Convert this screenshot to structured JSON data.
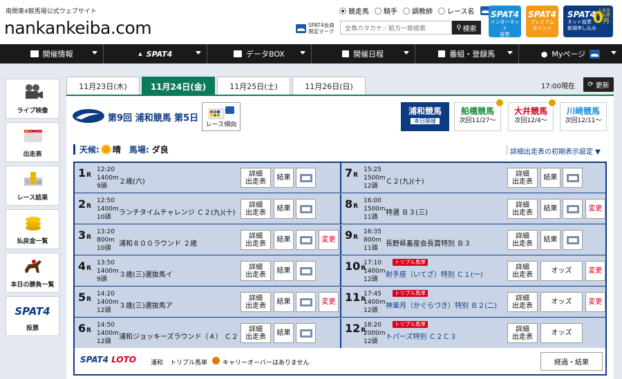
{
  "header": {
    "tagline": "南関東4競馬場公式ウェブサイト",
    "logo": "nankankeiba.com",
    "search_modes": [
      "競走馬",
      "騎手",
      "調教師",
      "レース名"
    ],
    "spat4_note_line1": "SPAT4会員",
    "spat4_note_line2": "限定マーク",
    "search_placeholder": "全角カタカナ／前方一致検索",
    "search_button": "検索",
    "promos": [
      {
        "logo": "SPAT4",
        "line1": "インターネット",
        "line2": "投票"
      },
      {
        "logo": "SPAT4",
        "line1": "プレミアム",
        "line2": "ポイント"
      },
      {
        "logo": "SPAT4",
        "line1": "ネット投票",
        "line2": "新規申し込み",
        "extra1": "入会金",
        "extra2": "年会費",
        "zero": "0",
        "yen": "円"
      }
    ]
  },
  "nav": [
    {
      "label": "開催情報",
      "icon": "calendar-grid-icon"
    },
    {
      "label": "SPAT4",
      "icon": "spat4-logo-icon"
    },
    {
      "label": "データBOX",
      "icon": "data-box-icon"
    },
    {
      "label": "開催日程",
      "icon": "calendar-icon"
    },
    {
      "label": "番組・登録馬",
      "icon": "program-icon"
    },
    {
      "label": "Myページ",
      "icon": "person-icon"
    }
  ],
  "sidebar": [
    {
      "label": "ライブ映像",
      "icon": "video-camera-icon"
    },
    {
      "label": "出走表",
      "icon": "entry-table-icon"
    },
    {
      "label": "レース結果",
      "icon": "race-result-icon"
    },
    {
      "label": "払戻金一覧",
      "icon": "coins-icon"
    },
    {
      "label": "本日の勝負一覧",
      "icon": "racehorse-icon"
    },
    {
      "label": "投票",
      "logo": "SPAT4"
    }
  ],
  "date_tabs": [
    "11月23日(木)",
    "11月24日(金)",
    "11月25日(土)",
    "11月26日(日)"
  ],
  "active_date": 1,
  "time_now": "17:00現在",
  "update_button": "更新",
  "meeting": "第9回 浦和競馬 第5日",
  "trend_button": "レース傾向",
  "venues": [
    {
      "name": "浦和競馬",
      "sub": "本日開催",
      "color": "#ffffff"
    },
    {
      "name": "船橋競馬",
      "sub": "次回11/27〜",
      "color": "#1a8a3c"
    },
    {
      "name": "大井競馬",
      "sub": "次回12/4〜",
      "color": "#d7001e"
    },
    {
      "name": "川崎競馬",
      "sub": "次回12/11〜",
      "color": "#1b8fd6"
    }
  ],
  "weather": {
    "weather_label": "天候:",
    "weather_value": "晴",
    "track_label": "馬場:",
    "track_value": "ダ良"
  },
  "initial_setting_link": "詳細出走表の初期表示設定 ▼",
  "race_unit": "R",
  "buttons": {
    "detail_line1": "詳細",
    "detail_line2": "出走表",
    "result": "結果",
    "odds": "オッズ",
    "change": "変更",
    "triple": "トリプル馬単"
  },
  "races": [
    {
      "no": "1",
      "time": "12:20",
      "dist": "1400m",
      "heads": "9頭",
      "name": "２歳(六)",
      "change": false,
      "triple": false,
      "odds": false,
      "link": false
    },
    {
      "no": "2",
      "time": "12:50",
      "dist": "1400m",
      "heads": "10頭",
      "name": "ランチタイムチャレンジ Ｃ２(九)(十)",
      "change": false,
      "triple": false,
      "odds": false,
      "link": false
    },
    {
      "no": "3",
      "time": "13:20",
      "dist": "800m",
      "heads": "10頭",
      "name": "浦和８００ラウンド ２歳",
      "change": true,
      "triple": false,
      "odds": false,
      "link": false
    },
    {
      "no": "4",
      "time": "13:50",
      "dist": "1400m",
      "heads": "9頭",
      "name": "３歳(三)選抜馬イ",
      "change": false,
      "triple": false,
      "odds": false,
      "link": false
    },
    {
      "no": "5",
      "time": "14:20",
      "dist": "1400m",
      "heads": "12頭",
      "name": "３歳(三)選抜馬ア",
      "change": true,
      "triple": false,
      "odds": false,
      "link": false
    },
    {
      "no": "6",
      "time": "14:50",
      "dist": "1400m",
      "heads": "12頭",
      "name": "浦和ジョッキーズラウンド（４） Ｃ２",
      "change": false,
      "triple": false,
      "odds": false,
      "link": false
    },
    {
      "no": "7",
      "time": "15:25",
      "dist": "1500m",
      "heads": "12頭",
      "name": "Ｃ２(九)(十)",
      "change": false,
      "triple": false,
      "odds": false,
      "link": false
    },
    {
      "no": "8",
      "time": "16:00",
      "dist": "1500m",
      "heads": "11頭",
      "name": "特選 Ｂ３(三)",
      "change": true,
      "triple": false,
      "odds": false,
      "link": false
    },
    {
      "no": "9",
      "time": "16:35",
      "dist": "800m",
      "heads": "11頭",
      "name": "長野県畜産会長賞特別 Ｂ３",
      "change": false,
      "triple": false,
      "odds": false,
      "link": false
    },
    {
      "no": "10",
      "time": "17:10",
      "dist": "1400m",
      "heads": "12頭",
      "name": "射手座（いてざ）特別 Ｃ１(一)",
      "change": true,
      "triple": true,
      "odds": true,
      "link": true
    },
    {
      "no": "11",
      "time": "17:45",
      "dist": "1400m",
      "heads": "12頭",
      "name": "神楽月（かぐらづき）特別 Ｂ２(二)",
      "change": true,
      "triple": true,
      "odds": true,
      "link": true
    },
    {
      "no": "12",
      "time": "18:20",
      "dist": "2000m",
      "heads": "12頭",
      "name": "トパーズ特別 Ｃ２Ｃ３",
      "change": false,
      "triple": true,
      "odds": true,
      "link": true
    }
  ],
  "footer": {
    "logo": "SPAT4",
    "logo2": "LOTO",
    "venue": "浦和",
    "triple": "トリプル馬単",
    "message": "キャリーオーバーはありません",
    "result_button": "経過・結果"
  }
}
